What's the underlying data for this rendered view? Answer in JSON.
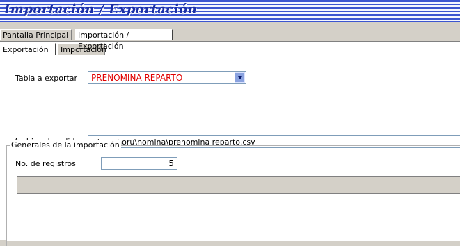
{
  "window": {
    "title": "Importación / Exportación"
  },
  "main_tabs": [
    {
      "label": "Pantalla Principal"
    },
    {
      "label": "Importación / Exportación"
    }
  ],
  "sub_tabs": [
    {
      "label": "Exportación"
    },
    {
      "label": "Importación"
    }
  ],
  "export": {
    "table_label": "Tabla a exportar",
    "table_value": "PRENOMINA REPARTO",
    "table_value_color": "#e00000",
    "output_label": "Archivo de salida",
    "output_value": "c:\\eco-horu\\nomina\\prenomina reparto.csv"
  },
  "group": {
    "title": "Generales de la importación",
    "records_label": "No. de registros",
    "records_value": "5"
  }
}
